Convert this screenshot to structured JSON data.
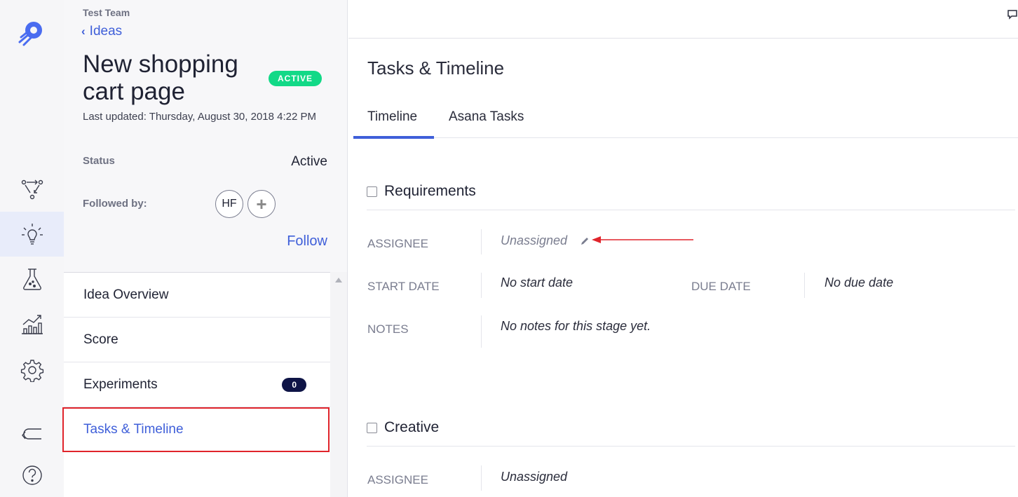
{
  "idea": {
    "team": "Test Team",
    "back_label": "Ideas",
    "title": "New shopping cart page",
    "status_badge": "ACTIVE",
    "last_updated": "Last updated: Thursday, August 30, 2018 4:22 PM",
    "status_label": "Status",
    "status_value": "Active",
    "followed_label": "Followed by:",
    "follower_initials": "HF",
    "follow_label": "Follow",
    "menu": [
      {
        "label": "Idea Overview"
      },
      {
        "label": "Score"
      },
      {
        "label": "Experiments",
        "count": "0"
      },
      {
        "label": "Tasks & Timeline"
      }
    ]
  },
  "main": {
    "title": "Tasks & Timeline",
    "tabs": [
      {
        "label": "Timeline"
      },
      {
        "label": "Asana Tasks"
      }
    ],
    "stages": [
      {
        "name": "Requirements",
        "assignee_label": "ASSIGNEE",
        "assignee_value": "Unassigned",
        "start_label": "START DATE",
        "start_value": "No start date",
        "due_label": "DUE DATE",
        "due_value": "No due date",
        "notes_label": "NOTES",
        "notes_value": "No notes for this stage yet."
      },
      {
        "name": "Creative",
        "assignee_label": "ASSIGNEE",
        "assignee_value": "Unassigned"
      }
    ]
  },
  "colors": {
    "accent": "#3f5fd9",
    "badge_green": "#12d987",
    "highlight_red": "#e0242b",
    "count_badge": "#0e1446"
  },
  "icons": {
    "rail": [
      "rocket-logo-icon",
      "workflow-icon",
      "lightbulb-icon",
      "flask-icon",
      "chart-icon",
      "gear-icon",
      "return-arrow-icon",
      "help-icon"
    ]
  }
}
